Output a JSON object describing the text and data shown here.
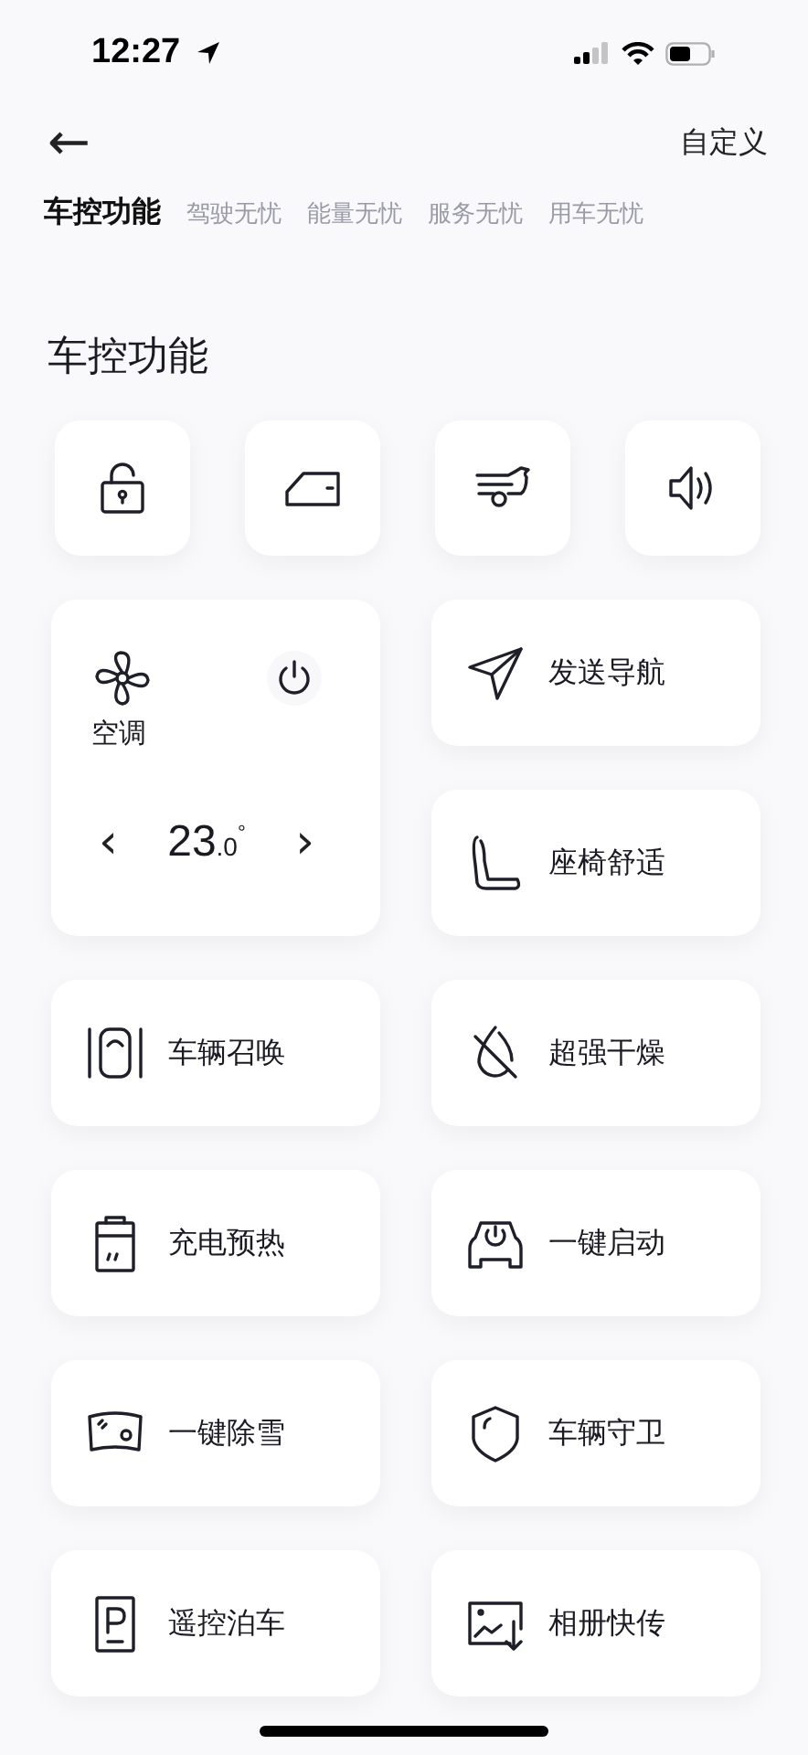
{
  "status_bar": {
    "time": "12:27"
  },
  "header": {
    "back": "←",
    "action": "自定义"
  },
  "tabs": [
    {
      "label": "车控功能",
      "selected": true
    },
    {
      "label": "驾驶无忧",
      "selected": false
    },
    {
      "label": "能量无忧",
      "selected": false
    },
    {
      "label": "服务无忧",
      "selected": false
    },
    {
      "label": "用车无忧",
      "selected": false
    }
  ],
  "section_title": "车控功能",
  "quick_controls": [
    {
      "kind": "lock"
    },
    {
      "kind": "door"
    },
    {
      "kind": "trunk"
    },
    {
      "kind": "horn"
    }
  ],
  "climate": {
    "label": "空调",
    "decrease": "‹",
    "temperature": "23$_{.0}$$^{°}$",
    "increase": "›"
  },
  "features": [
    {
      "kind": "navigate",
      "label": "发送导航"
    },
    {
      "kind": "seat",
      "label": "座椅舒适"
    },
    {
      "kind": "summon",
      "label": "车辆召唤"
    },
    {
      "kind": "dry",
      "label": "超强干燥"
    },
    {
      "kind": "battery",
      "label": "充电预热"
    },
    {
      "kind": "start",
      "label": "一键启动"
    },
    {
      "kind": "snow",
      "label": "一键除雪"
    },
    {
      "kind": "shield",
      "label": "车辆守卫"
    },
    {
      "kind": "parking",
      "label": "遥控泊车"
    },
    {
      "kind": "album",
      "label": "相册快传"
    }
  ]
}
